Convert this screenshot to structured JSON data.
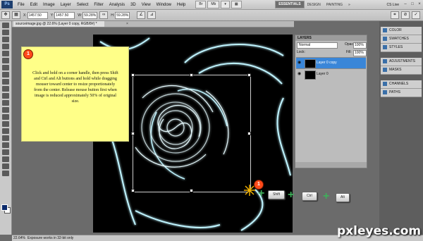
{
  "menu": {
    "logo": "Ps",
    "items": [
      "File",
      "Edit",
      "Image",
      "Layer",
      "Select",
      "Filter",
      "Analysis",
      "3D",
      "View",
      "Window",
      "Help"
    ]
  },
  "workspace": {
    "essentials": "ESSENTIALS",
    "design": "DESIGN",
    "painting": "PAINTING",
    "more": "»",
    "cs_live": "CS Live"
  },
  "options_bar": {
    "x_label": "X:",
    "x_value": "1457.50",
    "y_label": "Y:",
    "y_value": "1457.50",
    "w_label": "W:",
    "w_value": "59.28%",
    "h_label": "H:",
    "h_value": "59.28%"
  },
  "document": {
    "tab_label": "sourceimage.jpg @ 22.6% (Layer 0 copy, RGB/8#) *",
    "close_glyph": "×"
  },
  "callout": {
    "number": "1",
    "text": "Click and hold on a corner handle, then press Shift and Ctrl and Alt buttons and hold while dragging mouser toward center to resize proportionately from the center.  Release mouse button first when image is reduced approximately 50% of original size."
  },
  "keys": {
    "marker_number": "1",
    "shift": "Shift",
    "ctrl": "Ctrl",
    "alt": "Alt",
    "plus": "+"
  },
  "layers_panel": {
    "title": "LAYERS",
    "blend_mode": "Normal",
    "opacity_label": "Opacity:",
    "opacity_value": "100%",
    "lock_label": "Lock:",
    "fill_label": "Fill:",
    "fill_value": "100%",
    "layers": [
      {
        "name": "Layer 0 copy",
        "selected": true
      },
      {
        "name": "Layer 0",
        "selected": false
      }
    ]
  },
  "dock": {
    "items": [
      "COLOR",
      "SWATCHES",
      "STYLES",
      "ADJUSTMENTS",
      "MASKS",
      "CHANNELS",
      "PATHS"
    ]
  },
  "status": {
    "zoom": "22.64%",
    "message": "Exposure works in 32-bit only"
  },
  "watermark": "pxleyes.com"
}
